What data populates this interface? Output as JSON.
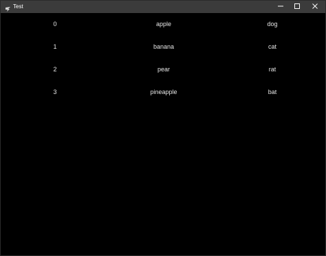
{
  "window": {
    "title": "Test",
    "app_icon": "tkinter-feather-icon",
    "controls": {
      "minimize_icon": "minimize-icon",
      "maximize_icon": "maximize-icon",
      "close_icon": "close-icon"
    },
    "colors": {
      "titlebar": "#3b3b3b",
      "background": "#000000",
      "text": "#e6e6e6"
    }
  },
  "table": {
    "rows": [
      {
        "index": "0",
        "fruit": "apple",
        "animal": "dog"
      },
      {
        "index": "1",
        "fruit": "banana",
        "animal": "cat"
      },
      {
        "index": "2",
        "fruit": "pear",
        "animal": "rat"
      },
      {
        "index": "3",
        "fruit": "pineapple",
        "animal": "bat"
      }
    ]
  }
}
